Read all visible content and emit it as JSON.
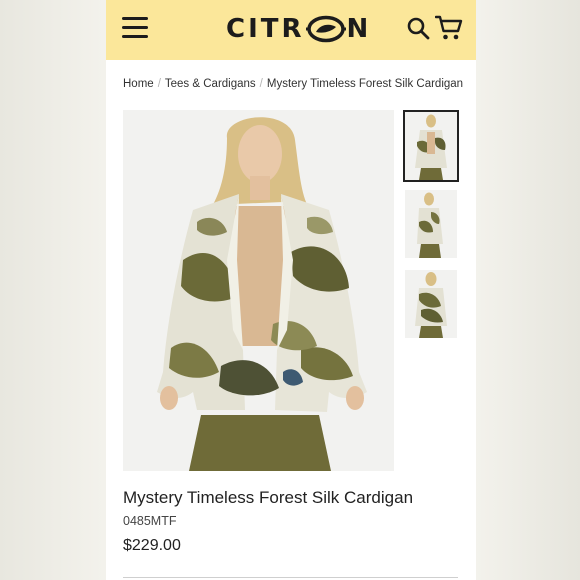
{
  "header": {
    "brand": "CITRON",
    "brand_before": "CITR",
    "brand_after": "N",
    "bg_color": "#fbe79a",
    "icons": [
      "menu-icon",
      "lemon-logo-icon",
      "search-icon",
      "cart-icon"
    ]
  },
  "breadcrumb": {
    "items": [
      "Home",
      "Tees & Cardigans",
      "Mystery Timeless Forest Silk Cardigan"
    ],
    "separator": "/"
  },
  "product": {
    "title": "Mystery Timeless Forest Silk Cardigan",
    "sku": "0485MTF",
    "price": "$229.00",
    "selected_thumbnail": 1,
    "thumbnail_count": 3
  },
  "colors": {
    "accent": "#fbe79a",
    "text": "#222222",
    "cardigan_olive": "#6e6a35",
    "cardigan_cream": "#e9e6d9"
  }
}
